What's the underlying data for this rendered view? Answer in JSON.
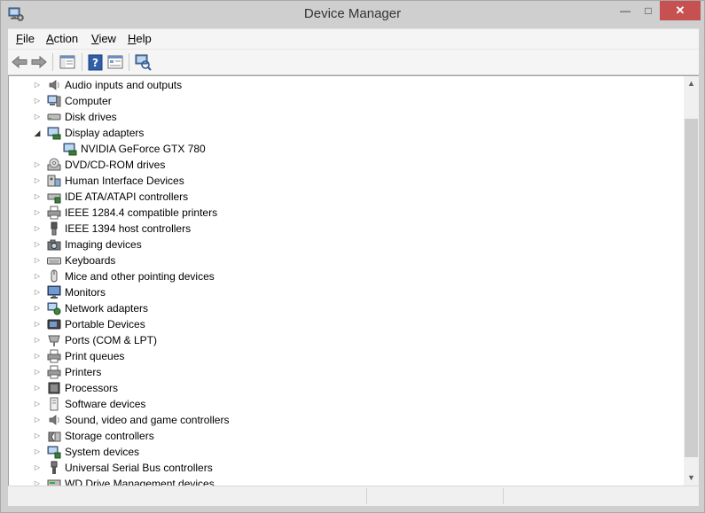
{
  "window": {
    "title": "Device Manager",
    "controls": {
      "minimize": "—",
      "maximize": "□",
      "close": "✕"
    },
    "accent_close": "#c75050"
  },
  "menu": [
    {
      "label": "File",
      "underline": "F",
      "rest": "ile"
    },
    {
      "label": "Action",
      "underline": "A",
      "rest": "ction"
    },
    {
      "label": "View",
      "underline": "V",
      "rest": "iew"
    },
    {
      "label": "Help",
      "underline": "H",
      "rest": "elp"
    }
  ],
  "toolbar": {
    "buttons": [
      {
        "name": "back-button",
        "icon": "arrow-left-icon"
      },
      {
        "name": "forward-button",
        "icon": "arrow-right-icon"
      },
      {
        "name": "show-hide-console-tree-button",
        "icon": "console-tree-icon"
      },
      {
        "name": "help-button",
        "icon": "help-icon"
      },
      {
        "name": "properties-button",
        "icon": "properties-icon"
      },
      {
        "name": "scan-hardware-button",
        "icon": "scan-hardware-icon"
      }
    ]
  },
  "tree": {
    "items": [
      {
        "label": "Audio inputs and outputs",
        "icon": "speaker-icon",
        "level": 0,
        "expander": "collapsed"
      },
      {
        "label": "Computer",
        "icon": "computer-icon",
        "level": 0,
        "expander": "collapsed"
      },
      {
        "label": "Disk drives",
        "icon": "disk-drive-icon",
        "level": 0,
        "expander": "collapsed"
      },
      {
        "label": "Display adapters",
        "icon": "display-adapter-icon",
        "level": 0,
        "expander": "expanded"
      },
      {
        "label": "NVIDIA GeForce GTX 780",
        "icon": "display-adapter-icon",
        "level": 1,
        "expander": "none"
      },
      {
        "label": "DVD/CD-ROM drives",
        "icon": "dvd-drive-icon",
        "level": 0,
        "expander": "collapsed"
      },
      {
        "label": "Human Interface Devices",
        "icon": "hid-icon",
        "level": 0,
        "expander": "collapsed"
      },
      {
        "label": "IDE ATA/ATAPI controllers",
        "icon": "ide-controller-icon",
        "level": 0,
        "expander": "collapsed"
      },
      {
        "label": "IEEE 1284.4 compatible printers",
        "icon": "printer-icon",
        "level": 0,
        "expander": "collapsed"
      },
      {
        "label": "IEEE 1394 host controllers",
        "icon": "firewire-icon",
        "level": 0,
        "expander": "collapsed"
      },
      {
        "label": "Imaging devices",
        "icon": "camera-icon",
        "level": 0,
        "expander": "collapsed"
      },
      {
        "label": "Keyboards",
        "icon": "keyboard-icon",
        "level": 0,
        "expander": "collapsed"
      },
      {
        "label": "Mice and other pointing devices",
        "icon": "mouse-icon",
        "level": 0,
        "expander": "collapsed"
      },
      {
        "label": "Monitors",
        "icon": "monitor-icon",
        "level": 0,
        "expander": "collapsed"
      },
      {
        "label": "Network adapters",
        "icon": "network-adapter-icon",
        "level": 0,
        "expander": "collapsed"
      },
      {
        "label": "Portable Devices",
        "icon": "portable-device-icon",
        "level": 0,
        "expander": "collapsed"
      },
      {
        "label": "Ports (COM & LPT)",
        "icon": "port-icon",
        "level": 0,
        "expander": "collapsed"
      },
      {
        "label": "Print queues",
        "icon": "printer-icon",
        "level": 0,
        "expander": "collapsed"
      },
      {
        "label": "Printers",
        "icon": "printer-icon",
        "level": 0,
        "expander": "collapsed"
      },
      {
        "label": "Processors",
        "icon": "processor-icon",
        "level": 0,
        "expander": "collapsed"
      },
      {
        "label": "Software devices",
        "icon": "software-device-icon",
        "level": 0,
        "expander": "collapsed"
      },
      {
        "label": "Sound, video and game controllers",
        "icon": "speaker-icon",
        "level": 0,
        "expander": "collapsed"
      },
      {
        "label": "Storage controllers",
        "icon": "storage-controller-icon",
        "level": 0,
        "expander": "collapsed"
      },
      {
        "label": "System devices",
        "icon": "system-device-icon",
        "level": 0,
        "expander": "collapsed"
      },
      {
        "label": "Universal Serial Bus controllers",
        "icon": "usb-icon",
        "level": 0,
        "expander": "collapsed"
      },
      {
        "label": "WD Drive Management devices",
        "icon": "wd-drive-icon",
        "level": 0,
        "expander": "collapsed"
      }
    ]
  },
  "scrollbar": {
    "up": "▲",
    "down": "▼"
  }
}
